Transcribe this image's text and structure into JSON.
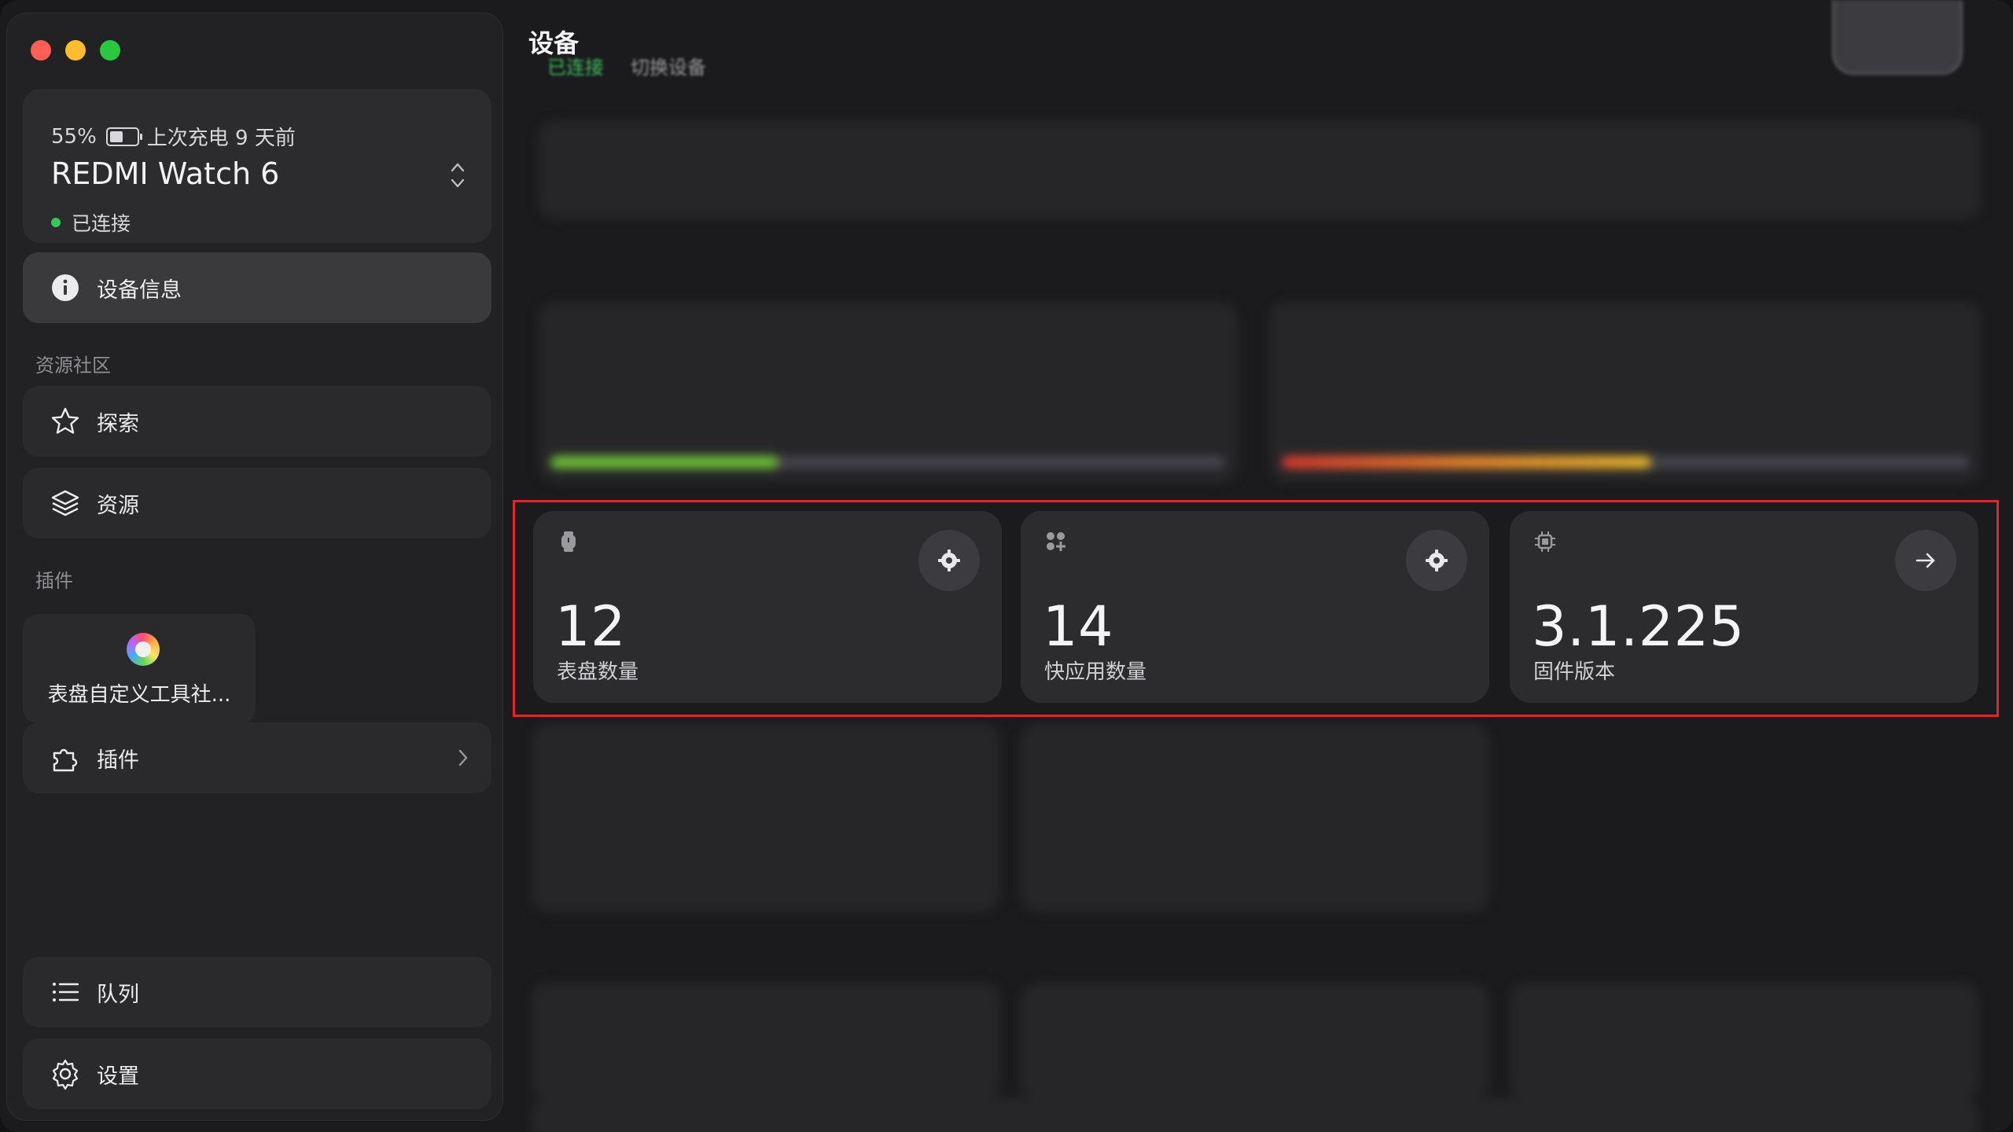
{
  "sidebar": {
    "device": {
      "battery_percent": "55%",
      "battery_level": 0.55,
      "last_charge": "上次充电 9 天前",
      "name": "REDMI Watch 6",
      "status": "已连接"
    },
    "nav_device_info": "设备信息",
    "section_community": "资源社区",
    "nav_explore": "探索",
    "nav_resources": "资源",
    "section_plugins": "插件",
    "plugin_tile_name": "表盘自定义工具社...",
    "nav_plugins": "插件",
    "nav_queue": "队列",
    "nav_settings": "设置"
  },
  "header": {
    "title": "设备",
    "status": "已连接",
    "switch_device": "切换设备"
  },
  "stats": [
    {
      "value": "12",
      "caption": "表盘数量",
      "icon": "watch-icon",
      "action": "gear-icon"
    },
    {
      "value": "14",
      "caption": "快应用数量",
      "icon": "apps-icon",
      "action": "gear-icon"
    },
    {
      "value": "3.1.225",
      "caption": "固件版本",
      "icon": "chip-icon",
      "action": "arrow-right-icon"
    }
  ],
  "colors": {
    "accent_green": "#34c759",
    "highlight_red": "#e0262b",
    "card_bg": "#2c2c2f"
  }
}
